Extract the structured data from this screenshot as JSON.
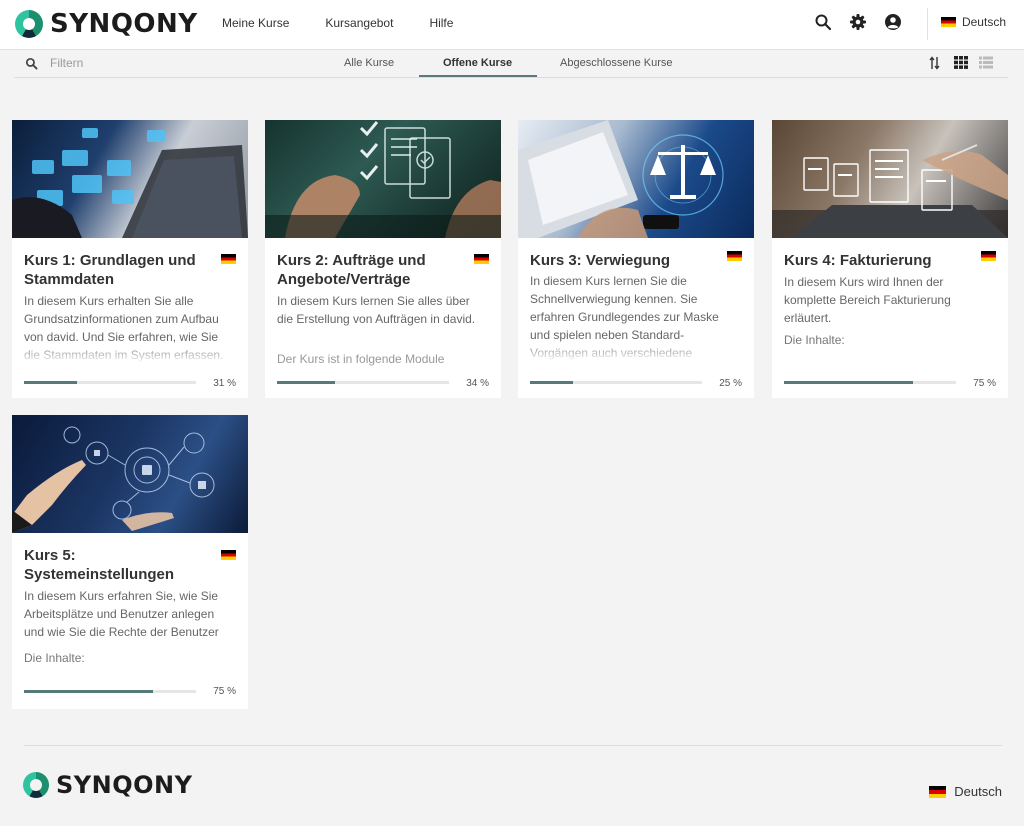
{
  "header": {
    "logo_text": "SYNQONY",
    "nav": [
      "Meine Kurse",
      "Kursangebot",
      "Hilfe"
    ],
    "language": "Deutsch"
  },
  "toolbar": {
    "filter_placeholder": "Filtern",
    "tabs": [
      {
        "label": "Alle Kurse",
        "active": false
      },
      {
        "label": "Offene Kurse",
        "active": true
      },
      {
        "label": "Abgeschlossene Kurse",
        "active": false
      }
    ]
  },
  "courses": [
    {
      "title": "Kurs 1: Grundlagen und Stammdaten",
      "description": "In diesem Kurs erhalten Sie alle Grundsatzinformationen zum Aufbau von david. Und Sie erfahren, wie Sie die Stammdaten im System erfassen.",
      "extra": "",
      "progress": 31,
      "progress_label": "31 %"
    },
    {
      "title": "Kurs 2: Aufträge und Angebote/Verträge",
      "description": "In diesem Kurs lernen Sie alles über die Erstellung von Aufträgen in david.",
      "extra": "Der Kurs ist in folgende Module unterteilt:",
      "progress": 34,
      "progress_label": "34 %"
    },
    {
      "title": "Kurs 3: Verwiegung",
      "description": "In diesem Kurs lernen Sie die Schnellverwiegung kennen. Sie erfahren Grundlegendes zur Maske und spielen neben Standard-Vorgängen auch verschiedene Sonderfälle durch.",
      "extra": "",
      "progress": 25,
      "progress_label": "25 %"
    },
    {
      "title": "Kurs 4: Fakturierung",
      "description": "In diesem Kurs wird Ihnen der komplette Bereich Fakturierung erläutert.",
      "extra": "Die Inhalte:",
      "progress": 75,
      "progress_label": "75 %"
    },
    {
      "title": "Kurs 5: Systemeinstellungen",
      "description": "In diesem Kurs erfahren Sie, wie Sie Arbeitsplätze und Benutzer anlegen und wie Sie die Rechte der Benutzer",
      "extra": "Die Inhalte:",
      "progress": 75,
      "progress_label": "75 %"
    }
  ],
  "footer": {
    "logo_text": "SYNQONY",
    "language": "Deutsch"
  },
  "colors": {
    "accent": "#557a7a",
    "logo_green": "#1b8f6e",
    "logo_dark": "#0f2a3a"
  },
  "icons": [
    "search-icon",
    "gear-icon",
    "account-icon",
    "sort-icon",
    "grid-view-icon",
    "list-view-icon",
    "flag-de-icon"
  ]
}
